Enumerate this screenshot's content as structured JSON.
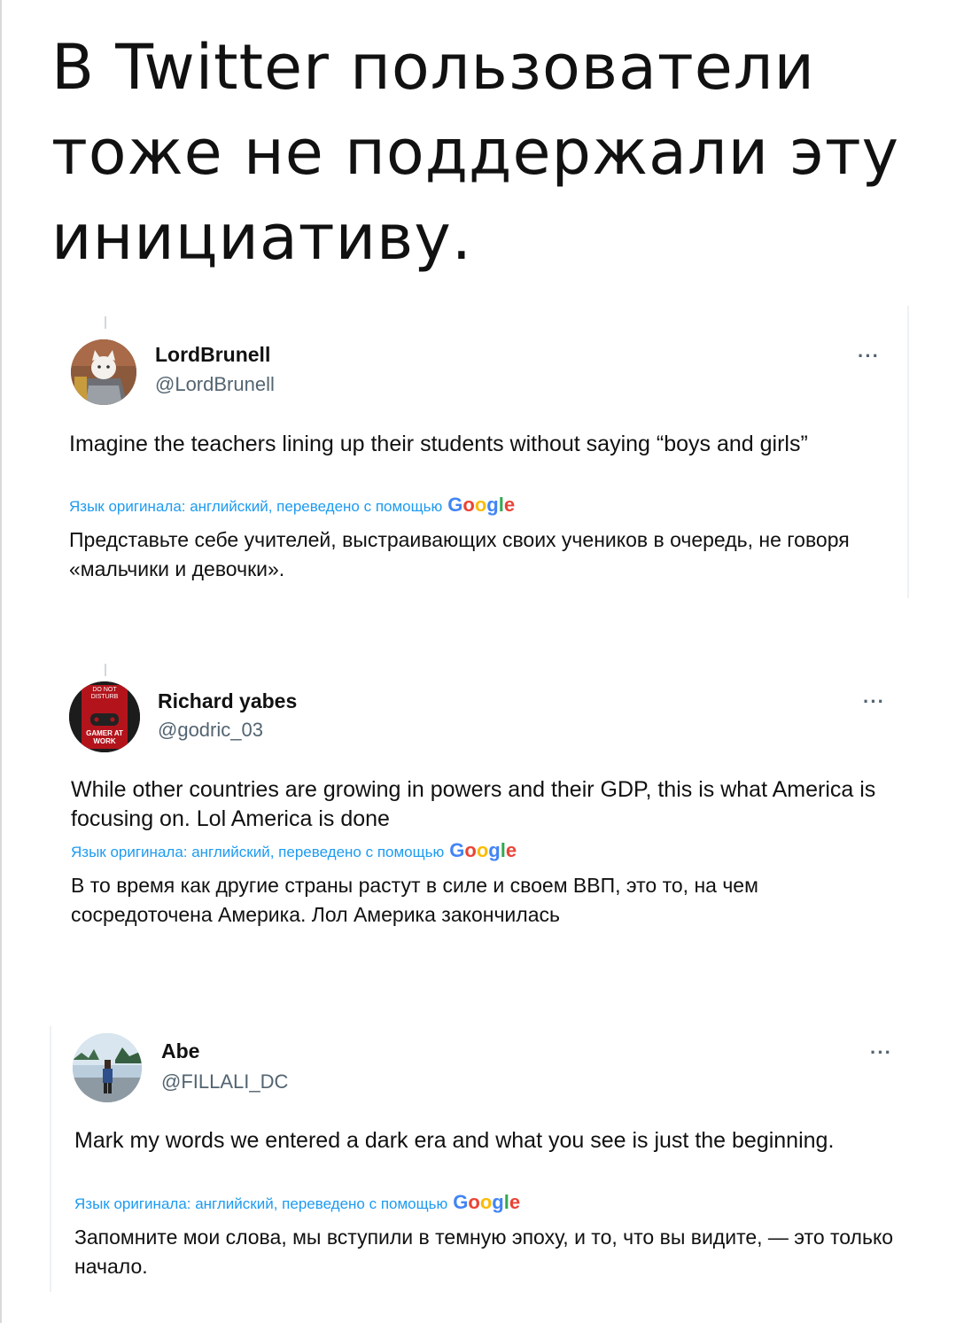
{
  "headline": "В Twitter пользователи тоже не поддержали эту инициативу.",
  "translation_label": "Язык оригинала: английский, переведено с помощью",
  "google_word": [
    "G",
    "o",
    "o",
    "g",
    "l",
    "e"
  ],
  "more_label": "···",
  "tweets": [
    {
      "name": "LordBrunell",
      "handle": "@LordBrunell",
      "text_en": "Imagine the teachers lining up their students without saying “boys and girls”",
      "text_ru": "Представьте себе учителей, выстраивающих своих учеников в очередь, не говоря «мальчики и девочки»."
    },
    {
      "name": "Richard yabes",
      "handle": "@godric_03",
      "avatar_text_top": "DO NOT DISTURB",
      "avatar_text_bottom": "GAMER AT WORK",
      "text_en": "While other countries are growing in powers and their GDP, this is what America is focusing on. Lol America is done",
      "text_ru": "В то время как другие страны растут в силе и своем ВВП, это то, на чем сосредоточена Америка. Лол Америка закончилась"
    },
    {
      "name": "Abe",
      "handle": "@FILLALI_DC",
      "text_en": "Mark my words we entered a dark era and what you see is just the beginning.",
      "text_ru": "Запомните мои слова, мы вступили в темную эпоху, и то, что вы видите, — это только начало."
    }
  ]
}
